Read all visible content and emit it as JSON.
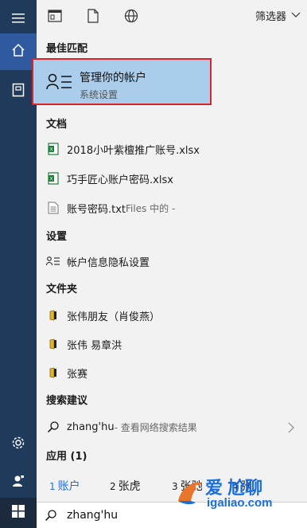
{
  "toolbar": {
    "icons": [
      "apps-icon",
      "document-icon",
      "globe-icon"
    ],
    "filter_label": "筛选器"
  },
  "sections": {
    "best_match": "最佳匹配",
    "documents": "文档",
    "settings": "设置",
    "folders": "文件夹",
    "suggestions": "搜索建议",
    "apps": "应用 (1)"
  },
  "best_match": {
    "title": "管理你的帐户",
    "subtitle": "系统设置"
  },
  "documents": [
    {
      "name": "2018小叶紫檀推广账号.xlsx",
      "meta": "",
      "icon": "excel-icon"
    },
    {
      "name": "巧手匠心账户密码.xlsx",
      "meta": "",
      "icon": "excel-icon"
    },
    {
      "name": "账号密码.txt",
      "meta": "Files 中的 -",
      "icon": "text-file-icon"
    }
  ],
  "settings": [
    {
      "name": "帐户信息隐私设置",
      "icon": "account-icon"
    }
  ],
  "folders": [
    {
      "name": "张伟朋友（肖俊燕）"
    },
    {
      "name": "张伟 易章洪"
    },
    {
      "name": "张赛"
    }
  ],
  "suggestion": {
    "query": "zhang'hu",
    "hint": " - 查看网络搜索结果"
  },
  "tabs": [
    {
      "num": "1",
      "label": "账户"
    },
    {
      "num": "2",
      "label": "张虎"
    },
    {
      "num": "3",
      "label": "张驰"
    },
    {
      "num": "4",
      "label": "张"
    }
  ],
  "search": {
    "value": "zhang'hu"
  },
  "watermark": {
    "text": "爱 尬聊",
    "url": "igaliao.com"
  },
  "colors": {
    "rail": "#1f3a5a",
    "selected_bg": "#a9cdeb",
    "highlight_border": "#d8242a",
    "accent": "#1f6fd6"
  }
}
